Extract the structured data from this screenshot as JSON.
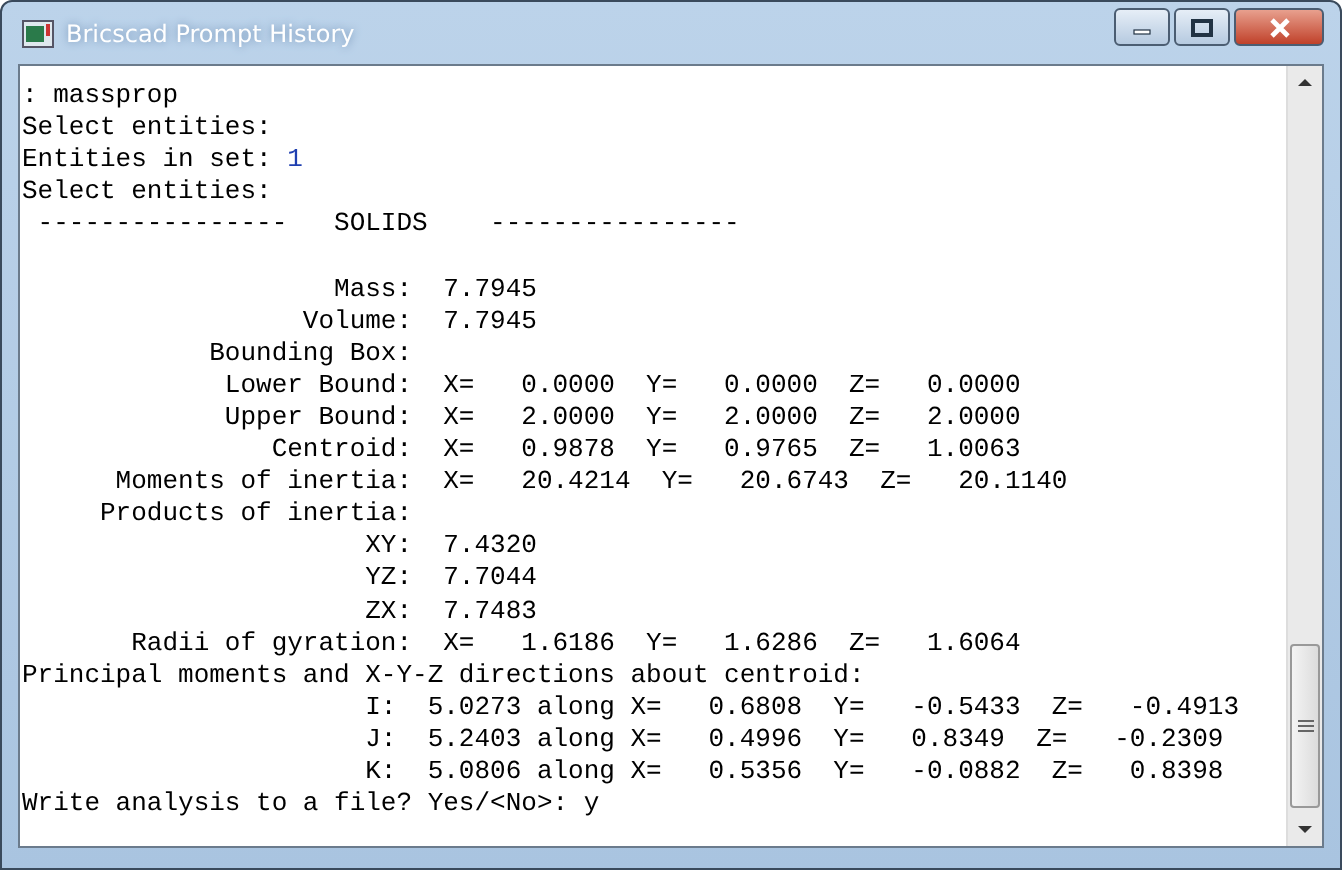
{
  "window": {
    "title": "Bricscad Prompt History"
  },
  "lines": [
    {
      "text": ": massprop"
    },
    {
      "text": "Select entities:"
    },
    {
      "text": "Entities in set: ",
      "value": "1"
    },
    {
      "text": "Select entities:"
    },
    {
      "text": " ----------------   SOLIDS    ----------------"
    },
    {
      "kind": "blank"
    },
    {
      "text": "                    Mass:  7.7945"
    },
    {
      "text": "                  Volume:  7.7945"
    },
    {
      "text": "            Bounding Box:"
    },
    {
      "text": "             Lower Bound:  X=   0.0000  Y=   0.0000  Z=   0.0000"
    },
    {
      "text": "             Upper Bound:  X=   2.0000  Y=   2.0000  Z=   2.0000"
    },
    {
      "text": "                Centroid:  X=   0.9878  Y=   0.9765  Z=   1.0063"
    },
    {
      "text": "      Moments of inertia:  X=   20.4214  Y=   20.6743  Z=   20.1140"
    },
    {
      "text": "     Products of inertia:"
    },
    {
      "text": "                      XY:  7.4320"
    },
    {
      "text": "                      YZ:  7.7044"
    },
    {
      "text": "                      ZX:  7.7483"
    },
    {
      "text": "       Radii of gyration:  X=   1.6186  Y=   1.6286  Z=   1.6064"
    },
    {
      "text": "Principal moments and X-Y-Z directions about centroid:"
    },
    {
      "text": "                      I:  5.0273 along X=   0.6808  Y=   -0.5433  Z=   -0.4913"
    },
    {
      "text": "                      J:  5.2403 along X=   0.4996  Y=   0.8349  Z=   -0.2309"
    },
    {
      "text": "                      K:  5.0806 along X=   0.5356  Y=   -0.0882  Z=   0.8398"
    },
    {
      "text": "Write analysis to a file? Yes/<No>: y"
    }
  ]
}
